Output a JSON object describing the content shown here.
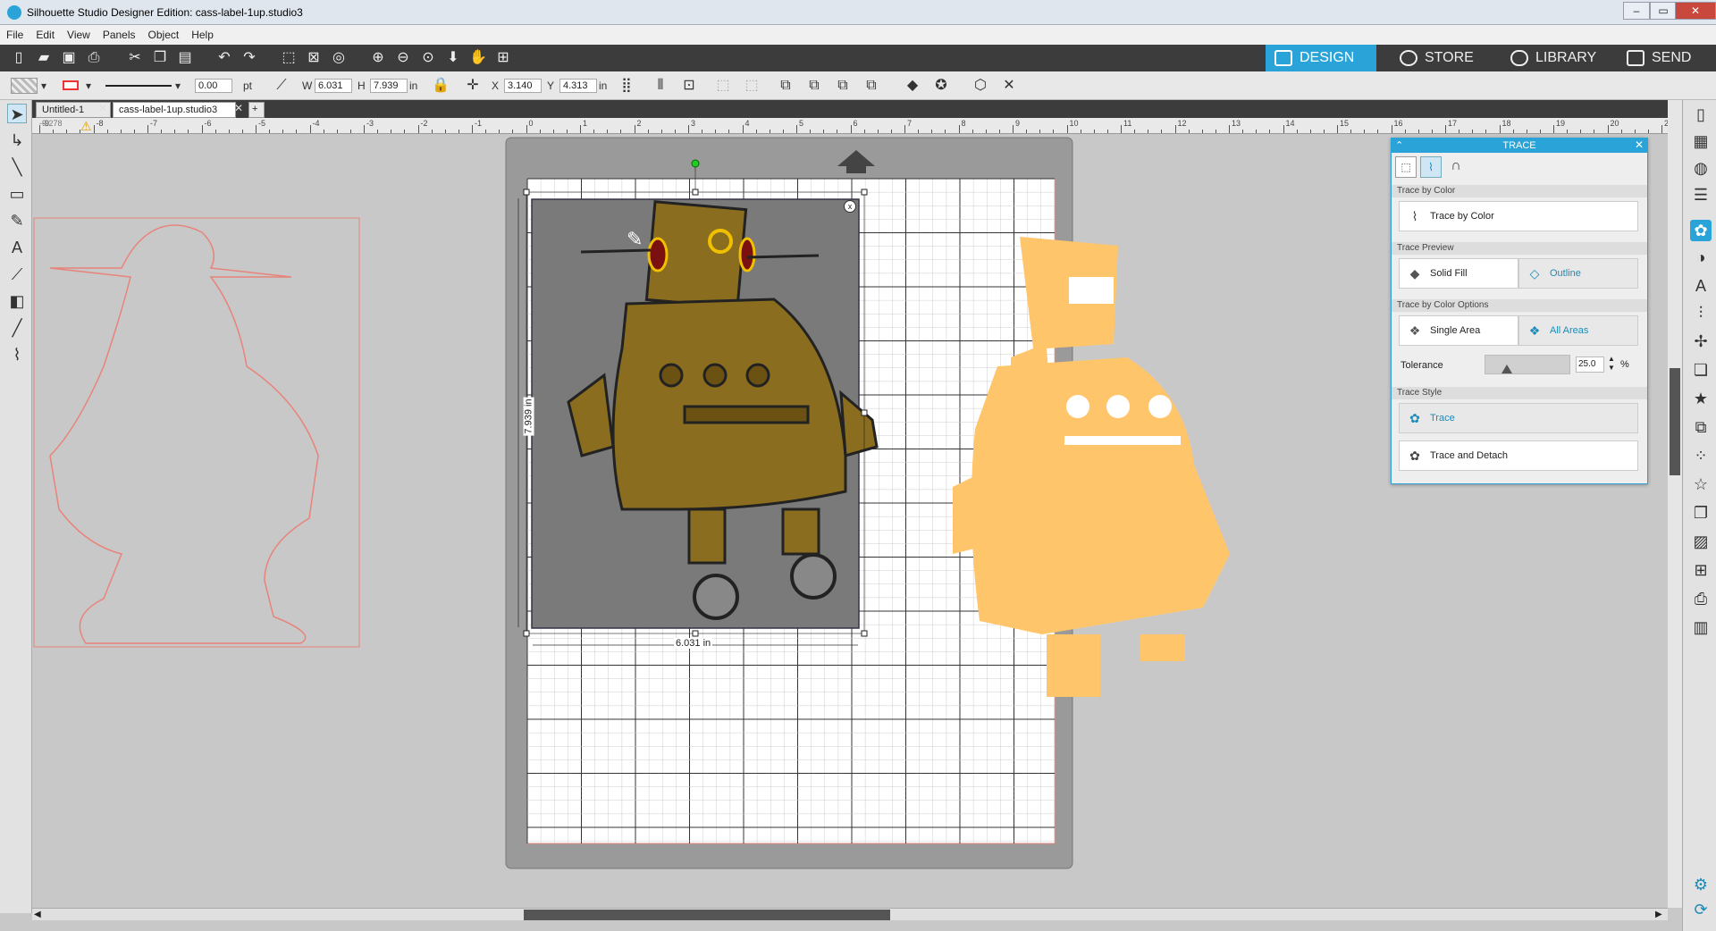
{
  "window": {
    "title": "Silhouette Studio Designer Edition: cass-label-1up.studio3",
    "controls": [
      "–",
      "▭",
      "✕"
    ]
  },
  "menu": [
    "File",
    "Edit",
    "View",
    "Panels",
    "Object",
    "Help"
  ],
  "nav_tabs": [
    {
      "label": "DESIGN",
      "active": true
    },
    {
      "label": "STORE",
      "active": false
    },
    {
      "label": "LIBRARY",
      "active": false
    },
    {
      "label": "SEND",
      "active": false
    }
  ],
  "line_props": {
    "width_value": "0.00",
    "unit": "pt"
  },
  "size": {
    "w_label": "W",
    "w_value": "6.031",
    "h_label": "H",
    "h_value": "7.939",
    "unit": "in"
  },
  "position": {
    "x_label": "X",
    "x_value": "3.140",
    "y_label": "Y",
    "y_value": "4.313",
    "unit": "in"
  },
  "doc_tabs": [
    {
      "label": "Untitled-1"
    },
    {
      "label": "cass-label-1up.studio3"
    }
  ],
  "ruler_labels": [
    "-9",
    "-8",
    "-7",
    "-6",
    "-5",
    "-4",
    "-3",
    "-2",
    "-1",
    "0",
    "1",
    "2",
    "3",
    "4",
    "5",
    "6",
    "7",
    "8",
    "9",
    "10",
    "11",
    "12",
    "13",
    "14",
    "15",
    "16",
    "17",
    "18",
    "19",
    "20",
    "21"
  ],
  "cursor_readout": "-9.278",
  "dimension_labels": {
    "width": "6.031 in",
    "height": "7.939 in",
    "close_badge": "x"
  },
  "trace_panel": {
    "title": "TRACE",
    "sections": {
      "trace_by_color": "Trace by Color",
      "trace_preview": "Trace Preview",
      "trace_by_color_options": "Trace by Color Options",
      "trace_style": "Trace Style"
    },
    "trace_by_color_button": "Trace by Color",
    "preview_solid_fill": "Solid Fill",
    "preview_outline": "Outline",
    "single_area": "Single Area",
    "all_areas": "All Areas",
    "tolerance_label": "Tolerance",
    "tolerance_value": "25.0",
    "tolerance_unit": "%",
    "tolerance_level": 0.25,
    "trace_button": "Trace",
    "trace_detach_button": "Trace and Detach"
  },
  "colors": {
    "accent": "#2aa4d8",
    "robot_brown": "#8a6d1e",
    "trace_fill": "#ffc56b",
    "cut_line": "#e8837a"
  }
}
